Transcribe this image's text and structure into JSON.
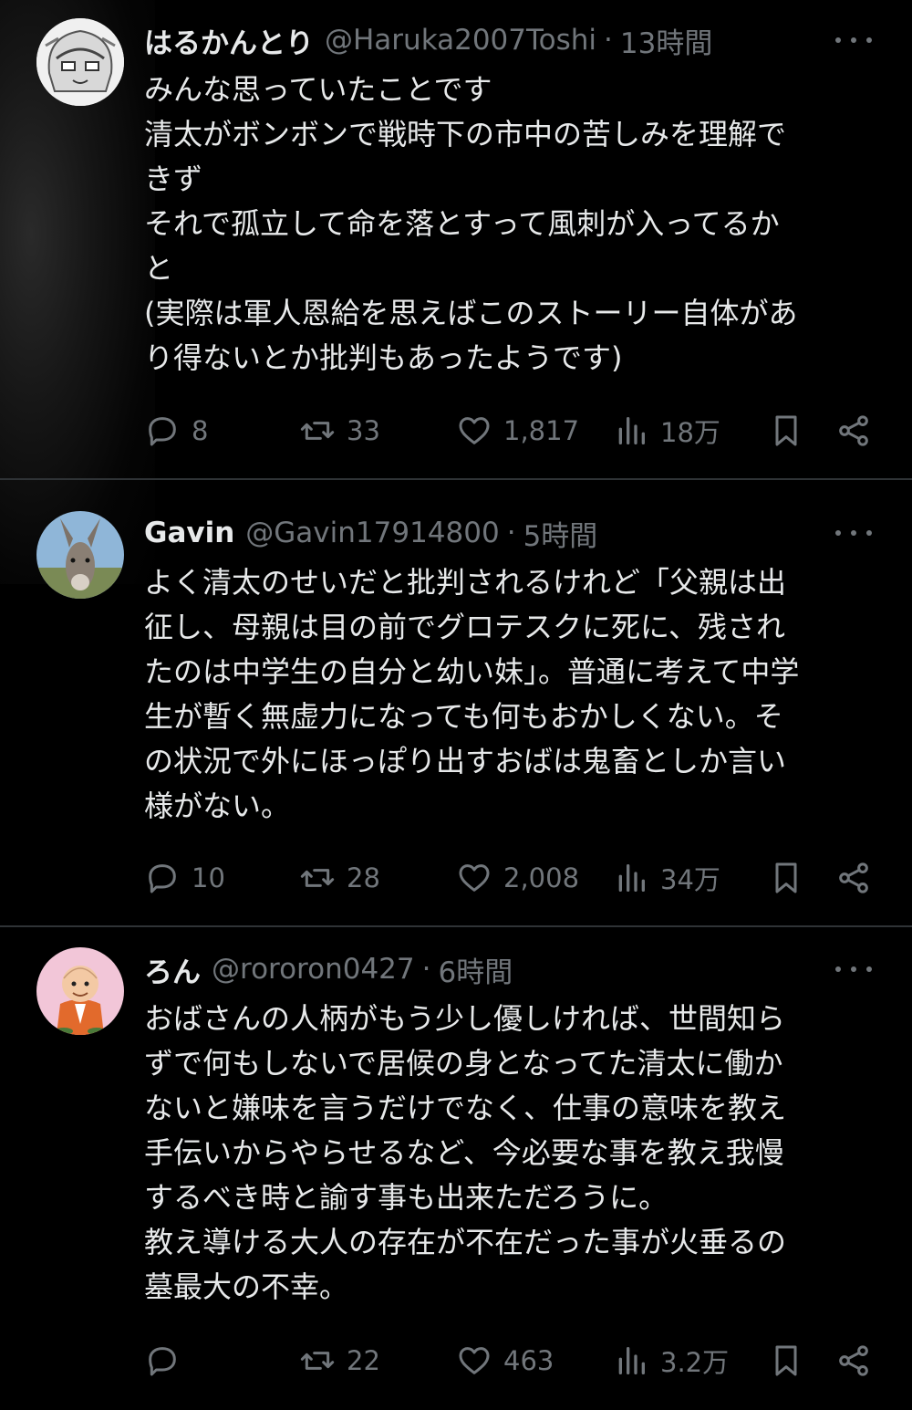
{
  "tweets": [
    {
      "name": "はるかんとり",
      "handle": "@Haruka2007Toshi",
      "time": "13時間",
      "lines": [
        "みんな思っていたことです",
        "清太がボンボンで戦時下の市中の苦しみを理解で",
        "きず",
        "それで孤立して命を落とすって風刺が入ってるか",
        "と",
        "(実際は軍人恩給を思えばこのストーリー自体があ",
        "り得ないとか批判もあったようです)"
      ],
      "replies": "8",
      "retweets": "33",
      "likes": "1,817",
      "views": "18万",
      "avatar": "anime-girl-avatar"
    },
    {
      "name": "Gavin",
      "handle": "@Gavin17914800",
      "time": "5時間",
      "lines": [
        "よく清太のせいだと批判されるけれど「父親は出",
        "征し、母親は目の前でグロテスクに死に、残され",
        "たのは中学生の自分と幼い妹」。普通に考えて中学",
        "生が暫く無虚力になっても何もおかしくない。そ",
        "の状況で外にほっぽり出すおばは鬼畜としか言い",
        "様がない。"
      ],
      "replies": "10",
      "retweets": "28",
      "likes": "2,008",
      "views": "34万",
      "avatar": "donkey-avatar"
    },
    {
      "name": "ろん",
      "handle": "@rororon0427",
      "time": "6時間",
      "lines": [
        "おばさんの人柄がもう少し優しければ、世間知ら",
        "ずで何もしないで居候の身となってた清太に働か",
        "ないと嫌味を言うだけでなく、仕事の意味を教え",
        "手伝いからやらせるなど、今必要な事を教え我慢",
        "するべき時と諭す事も出来ただろうに。",
        "教え導ける大人の存在が不在だった事が火垂るの",
        "墓最大の不幸。"
      ],
      "replies": "",
      "retweets": "22",
      "likes": "463",
      "views": "3.2万",
      "avatar": "cartoon-man-avatar"
    }
  ],
  "colors": {
    "background": "#000000",
    "text": "#e7e9ea",
    "muted": "#71767b",
    "divider": "#2f3336"
  },
  "icons": [
    "reply-icon",
    "retweet-icon",
    "like-icon",
    "views-icon",
    "bookmark-icon",
    "share-icon",
    "more-icon"
  ]
}
